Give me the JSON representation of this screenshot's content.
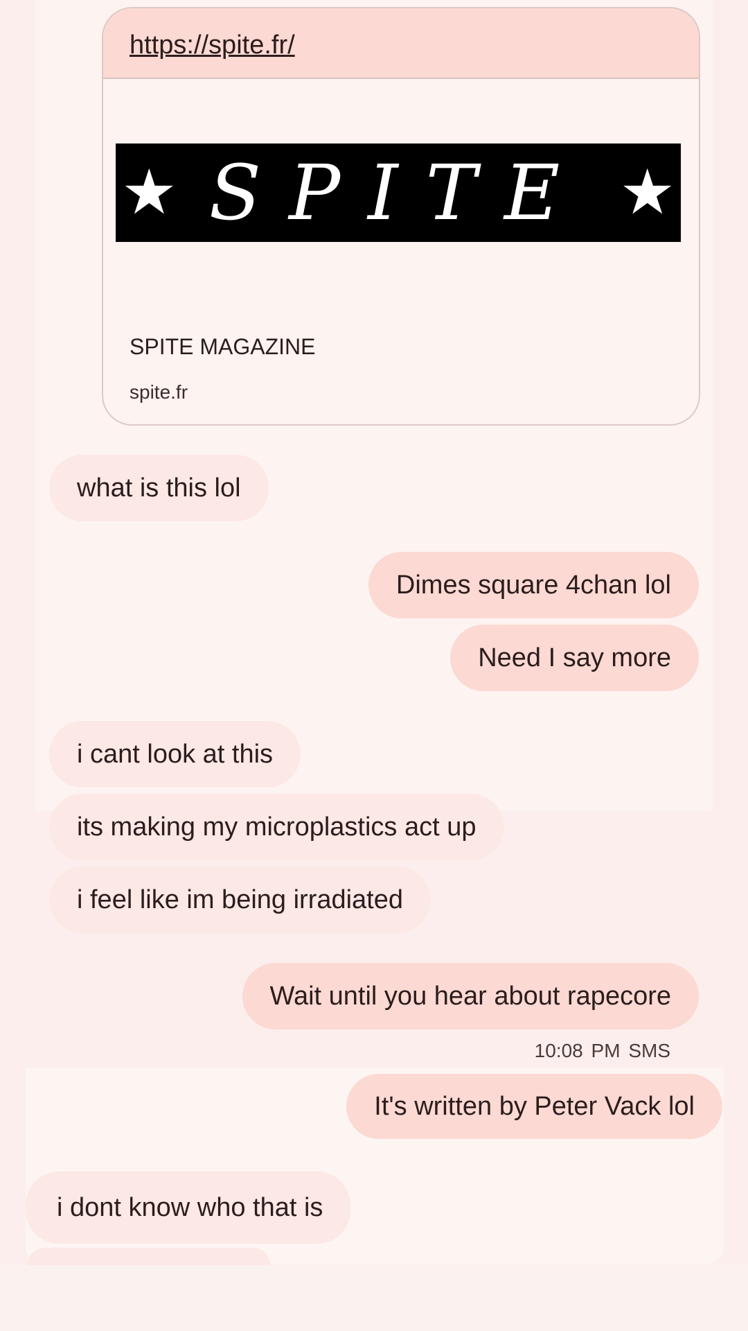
{
  "link_preview": {
    "url": "https://spite.fr/",
    "logo_text": "SPITE",
    "title": "SPITE MAGAZINE",
    "domain": "spite.fr"
  },
  "messages": [
    {
      "direction": "received",
      "text": "what is this lol"
    },
    {
      "direction": "sent",
      "text": "Dimes square 4chan lol"
    },
    {
      "direction": "sent",
      "text": "Need I say more"
    },
    {
      "direction": "received",
      "text": "i cant look at this"
    },
    {
      "direction": "received",
      "text": "its making my microplastics act up"
    },
    {
      "direction": "received",
      "text": "i feel like im being irradiated"
    },
    {
      "direction": "sent",
      "text": "Wait until you hear about rapecore"
    },
    {
      "direction": "sent",
      "text": "It's written by Peter Vack lol"
    },
    {
      "direction": "received",
      "text": "i dont know who that is"
    }
  ],
  "timestamp": "10:08 PM",
  "message_type": "SMS",
  "colors": {
    "sent": "#fcd9d3",
    "received": "#fce8e5",
    "background": "#fdf4f2"
  }
}
